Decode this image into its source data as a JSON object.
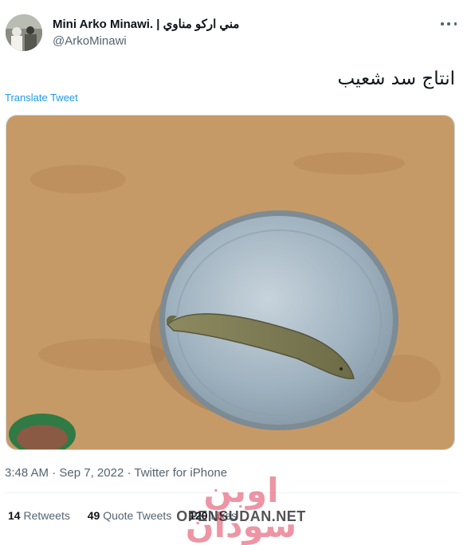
{
  "author": {
    "display_name": "Mini Arko Minawi. | مني اركو مناوي",
    "handle": "@ArkoMinawi"
  },
  "more_icon": "more-horizontal-icon",
  "tweet": {
    "text": "انتاج سد شعيب",
    "translate_label": "Translate Tweet",
    "media_description": "fish-on-metal-plate-photo"
  },
  "meta": {
    "time": "3:48 AM",
    "date": "Sep 7, 2022",
    "separator": "·",
    "source": "Twitter for iPhone"
  },
  "stats": {
    "retweets_count": "14",
    "retweets_label": "Retweets",
    "quotes_count": "49",
    "quotes_label": "Quote Tweets",
    "likes_count": "120",
    "likes_label": "Likes"
  },
  "watermark": {
    "arabic": "اوبن سودان",
    "latin": "OPENSUDAN.NET"
  },
  "colors": {
    "link": "#1d9bf0",
    "secondary_text": "#536471",
    "primary_text": "#0f1419"
  }
}
